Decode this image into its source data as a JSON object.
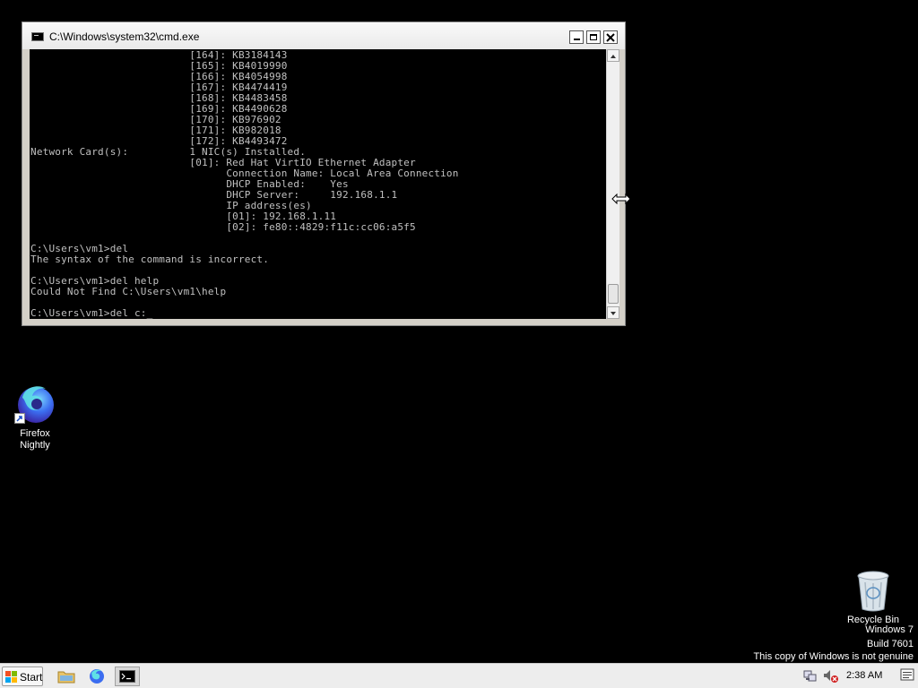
{
  "window": {
    "title": "C:\\Windows\\system32\\cmd.exe"
  },
  "console": {
    "lines": [
      "                          [164]: KB3184143",
      "                          [165]: KB4019990",
      "                          [166]: KB4054998",
      "                          [167]: KB4474419",
      "                          [168]: KB4483458",
      "                          [169]: KB4490628",
      "                          [170]: KB976902",
      "                          [171]: KB982018",
      "                          [172]: KB4493472",
      "Network Card(s):          1 NIC(s) Installed.",
      "                          [01]: Red Hat VirtIO Ethernet Adapter",
      "                                Connection Name: Local Area Connection",
      "                                DHCP Enabled:    Yes",
      "                                DHCP Server:     192.168.1.1",
      "                                IP address(es)",
      "                                [01]: 192.168.1.11",
      "                                [02]: fe80::4829:f11c:cc06:a5f5",
      "",
      "C:\\Users\\vm1>del",
      "The syntax of the command is incorrect.",
      "",
      "C:\\Users\\vm1>del help",
      "Could Not Find C:\\Users\\vm1\\help",
      "",
      "C:\\Users\\vm1>del c:"
    ],
    "cursor": "_"
  },
  "desktop": {
    "firefox_label_1": "Firefox",
    "firefox_label_2": "Nightly",
    "recycle_label": "Recycle Bin"
  },
  "watermark": {
    "line1": "Windows 7",
    "line2": "Build 7601",
    "line3": "This copy of Windows is not genuine"
  },
  "taskbar": {
    "start_label": "Start",
    "clock": "2:38 AM"
  },
  "colors": {
    "console_bg": "#000000",
    "console_text": "#c0c0c0",
    "desktop_bg": "#000000"
  }
}
